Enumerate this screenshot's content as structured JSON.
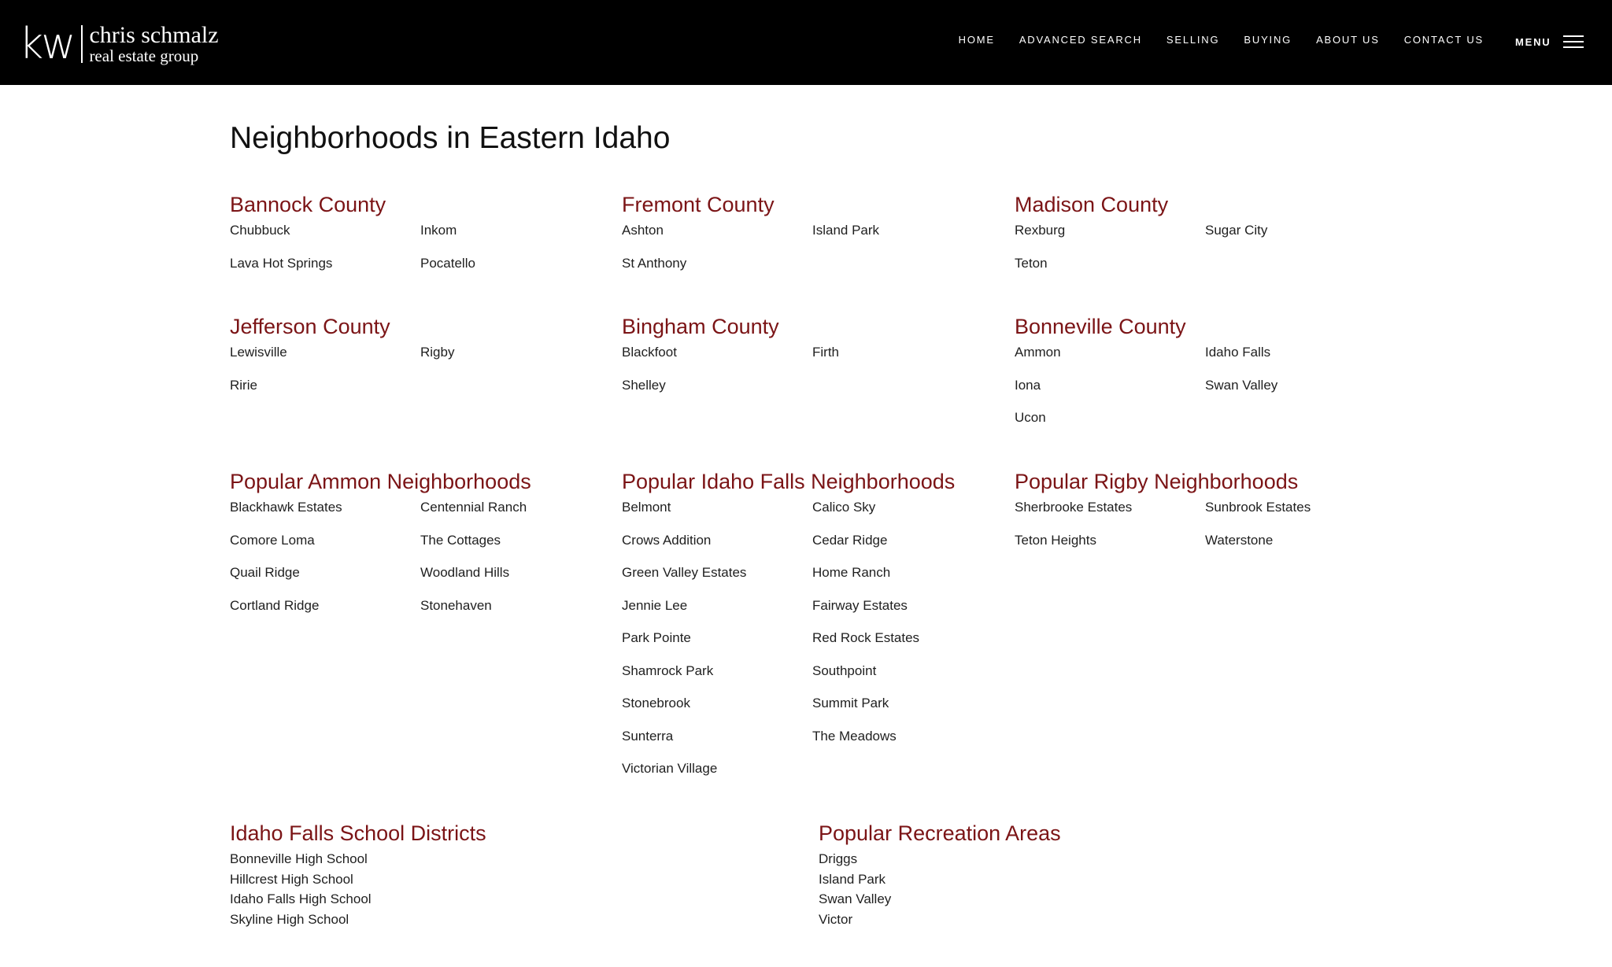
{
  "header": {
    "logo": {
      "mark": "kw",
      "name": "chris schmalz",
      "tagline": "real estate group"
    },
    "nav": [
      "HOME",
      "ADVANCED SEARCH",
      "SELLING",
      "BUYING",
      "ABOUT US",
      "CONTACT US"
    ],
    "menu_label": "MENU",
    "menu_icon": "hamburger-icon"
  },
  "page_title": "Neighborhoods in Eastern Idaho",
  "sections": [
    {
      "title": "Bannock County",
      "items": [
        "Chubbuck",
        "Inkom",
        "Lava Hot Springs",
        "Pocatello"
      ]
    },
    {
      "title": "Fremont County",
      "items": [
        "Ashton",
        "Island Park",
        "St Anthony"
      ]
    },
    {
      "title": "Madison County",
      "items": [
        "Rexburg",
        "Sugar City",
        "Teton"
      ]
    },
    {
      "title": "Jefferson County",
      "items": [
        "Lewisville",
        "Rigby",
        "Ririe"
      ]
    },
    {
      "title": "Bingham County",
      "items": [
        "Blackfoot",
        "Firth",
        "Shelley"
      ]
    },
    {
      "title": "Bonneville County",
      "items": [
        "Ammon",
        "Idaho Falls",
        "Iona",
        "Swan Valley",
        "Ucon"
      ]
    },
    {
      "title": "Popular Ammon Neighborhoods",
      "items": [
        "Blackhawk Estates",
        "Centennial Ranch",
        "Comore Loma",
        "The Cottages",
        "Quail Ridge",
        "Woodland Hills",
        "Cortland Ridge",
        "Stonehaven"
      ]
    },
    {
      "title": "Popular Idaho Falls Neighborhoods",
      "items": [
        "Belmont",
        "Calico Sky",
        "Crows Addition",
        "Cedar Ridge",
        "Green Valley Estates",
        "Home Ranch",
        "Jennie Lee",
        "Fairway Estates",
        "Park Pointe",
        "Red Rock Estates",
        "Shamrock Park",
        "Southpoint",
        "Stonebrook",
        "Summit Park",
        "Sunterra",
        "The Meadows",
        "Victorian Village"
      ]
    },
    {
      "title": "Popular Rigby Neighborhoods",
      "items": [
        "Sherbrooke Estates",
        "Sunbrook Estates",
        "Teton Heights",
        "Waterstone"
      ]
    },
    {
      "title": "Idaho Falls School Districts",
      "items": [
        "Bonneville High School",
        "Hillcrest High School",
        "Idaho Falls High School",
        "Skyline High School"
      ]
    },
    {
      "title": "Popular Recreation Areas",
      "items": [
        "Driggs",
        "Island Park",
        "Swan Valley",
        "Victor"
      ]
    }
  ]
}
